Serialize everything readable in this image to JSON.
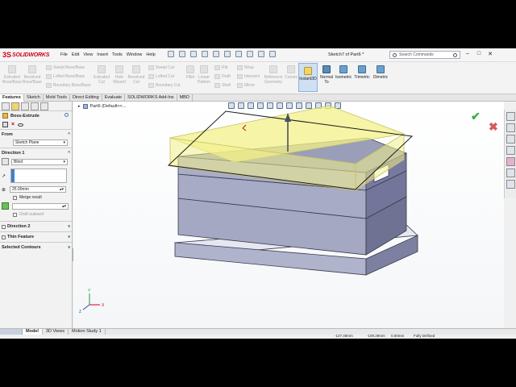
{
  "app": {
    "logo_mark": "3S",
    "logo_text": "SOLIDWORKS",
    "menu": [
      "File",
      "Edit",
      "View",
      "Insert",
      "Tools",
      "Window",
      "Help"
    ],
    "document_title": "Sketch7 of Part6 *",
    "search_placeholder": "Search Commands",
    "window_buttons": [
      "–",
      "□",
      "✕"
    ]
  },
  "ribbon": {
    "big_buttons": [
      {
        "label": "Extruded Boss/Base"
      },
      {
        "label": "Revolved Boss/Base"
      },
      {
        "label": "Extruded Cut"
      },
      {
        "label": "Hole Wizard"
      },
      {
        "label": "Revolved Cut"
      },
      {
        "label": "Fillet"
      },
      {
        "label": "Linear Pattern"
      },
      {
        "label": "Reference Geometry"
      },
      {
        "label": "Curves"
      },
      {
        "label": "Instant3D"
      },
      {
        "label": "Normal To"
      },
      {
        "label": "Isometric"
      },
      {
        "label": "Trimetric"
      },
      {
        "label": "Dimetric"
      }
    ],
    "small_buttons": [
      "Swept Boss/Base",
      "Lofted Boss/Base",
      "Boundary Boss/Base",
      "Swept Cut",
      "Lofted Cut",
      "Boundary Cut",
      "Rib",
      "Draft",
      "Shell",
      "Wrap",
      "Intersect",
      "Mirror"
    ]
  },
  "tabs": [
    "Features",
    "Sketch",
    "Mold Tools",
    "Direct Editing",
    "Evaluate",
    "SOLIDWORKS Add-Ins",
    "MBD"
  ],
  "active_tab": "Features",
  "property_manager": {
    "title": "Boss-Extrude",
    "from_label": "From",
    "from_value": "Sketch Plane",
    "direction1_label": "Direction 1",
    "end_condition": "Blind",
    "depth": "25.00mm",
    "merge_result": "Merge result",
    "draft_outward": "Draft outward",
    "direction2_label": "Direction 2",
    "thin_feature_label": "Thin Feature",
    "selected_contours_label": "Selected Contours",
    "chevron_up": "^",
    "chevron_down": "v",
    "dropdown_arrow": "▾",
    "spin_arrows": "▴▾"
  },
  "viewport": {
    "tree_label": "Part6  (Default<<...",
    "ok_symbol": "✔",
    "cancel_symbol": "✖",
    "triad": {
      "x": "X",
      "y": "Y",
      "z": "Z"
    }
  },
  "bottom_tabs": [
    "Model",
    "3D Views",
    "Motion Study 1"
  ],
  "status": {
    "x": "-127.49mm",
    "y": "-109.29mm",
    "z": "0.00mm",
    "state": "Fully Defined"
  },
  "colors": {
    "brand": "#d0021b",
    "body": "#a4a8c2",
    "preview": "#f2f08a",
    "accent": "#3f82c6"
  }
}
